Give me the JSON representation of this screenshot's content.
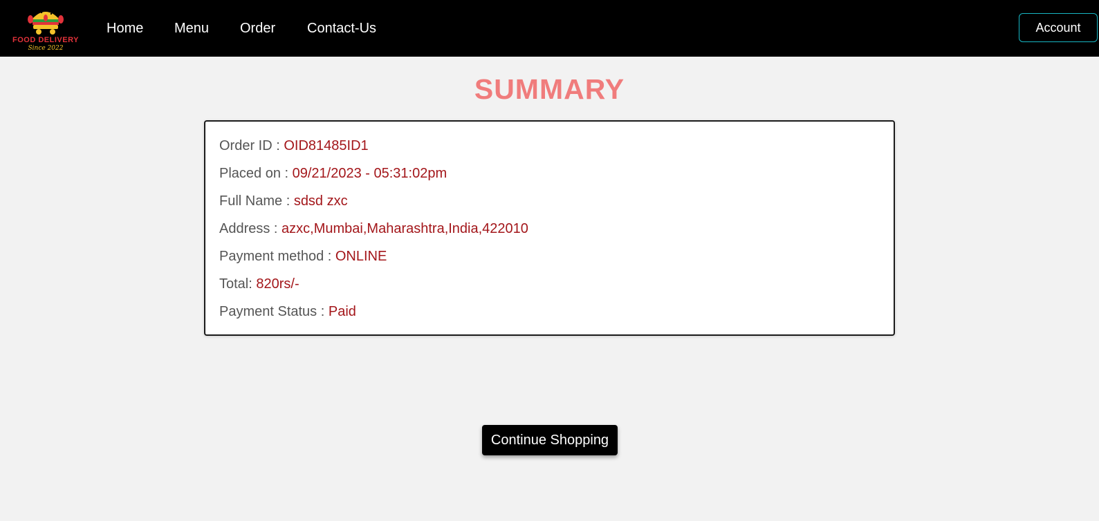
{
  "brand": {
    "name": "FOOD DELIVERY",
    "tagline": "Since 2022",
    "colors": {
      "red": "#e2323a",
      "yellow": "#f4c22b"
    }
  },
  "nav": {
    "items": [
      {
        "label": "Home"
      },
      {
        "label": "Menu"
      },
      {
        "label": "Order"
      },
      {
        "label": "Contact-Us"
      }
    ],
    "account_label": "Account"
  },
  "page": {
    "title": "SUMMARY",
    "title_color": "#f07c7c"
  },
  "summary": {
    "value_color": "#a3161a",
    "rows": [
      {
        "label": "Order ID : ",
        "value": "OID81485ID1"
      },
      {
        "label": "Placed on : ",
        "value": "09/21/2023 - 05:31:02pm"
      },
      {
        "label": "Full Name : ",
        "value": "sdsd zxc"
      },
      {
        "label": "Address : ",
        "value": "azxc,Mumbai,Maharashtra,India,422010"
      },
      {
        "label": "Payment method : ",
        "value": "ONLINE"
      },
      {
        "label": "Total: ",
        "value": "820rs/-"
      },
      {
        "label": "Payment Status : ",
        "value": "Paid"
      }
    ]
  },
  "actions": {
    "continue_label": "Continue Shopping"
  }
}
